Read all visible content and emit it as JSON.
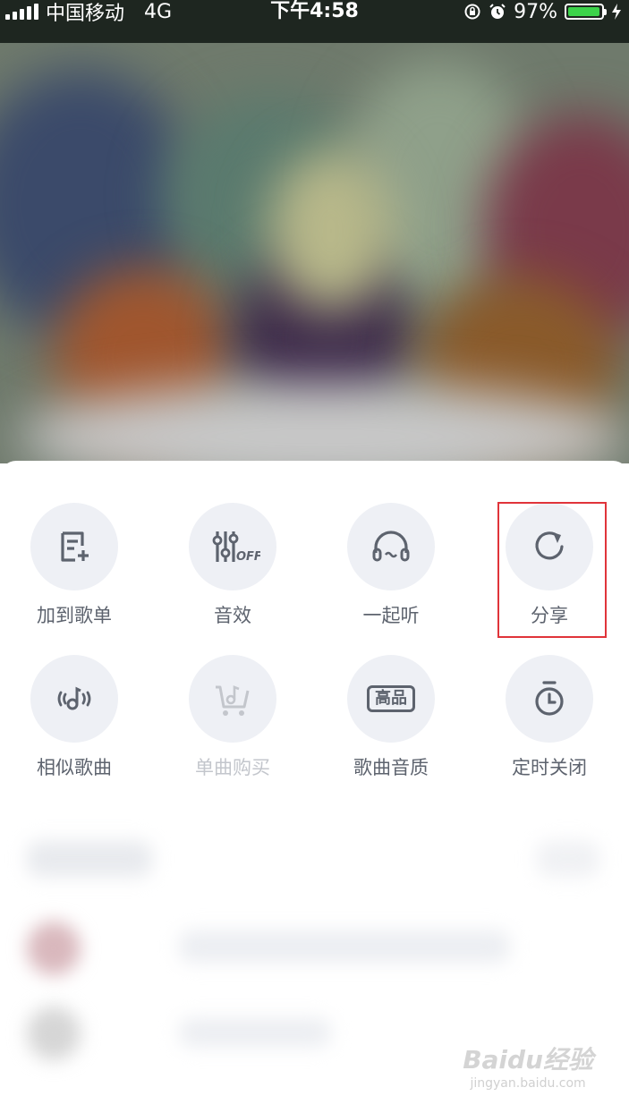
{
  "status_bar": {
    "carrier": "中国移动",
    "network": "4G",
    "time": "下午4:58",
    "battery": "97%",
    "battery_level": 0.97
  },
  "menu": {
    "row1": [
      {
        "label": "加到歌单",
        "icon": "add-to-playlist-icon"
      },
      {
        "label": "音效",
        "icon": "equalizer-off-icon"
      },
      {
        "label": "一起听",
        "icon": "headphones-icon"
      },
      {
        "label": "分享",
        "icon": "share-icon"
      }
    ],
    "row2": [
      {
        "label": "相似歌曲",
        "icon": "similar-songs-icon"
      },
      {
        "label": "单曲购买",
        "icon": "cart-music-icon",
        "disabled": true
      },
      {
        "label": "歌曲音质",
        "icon": "quality-badge-icon",
        "badge": "高品"
      },
      {
        "label": "定时关闭",
        "icon": "timer-icon"
      }
    ]
  },
  "watermark": {
    "logo": "Baidu经验",
    "url": "jingyan.baidu.com"
  },
  "colors": {
    "icon": "#5d636e",
    "icon_bg": "#eef0f5",
    "highlight": "#e0343a",
    "battery": "#3cd34a"
  }
}
